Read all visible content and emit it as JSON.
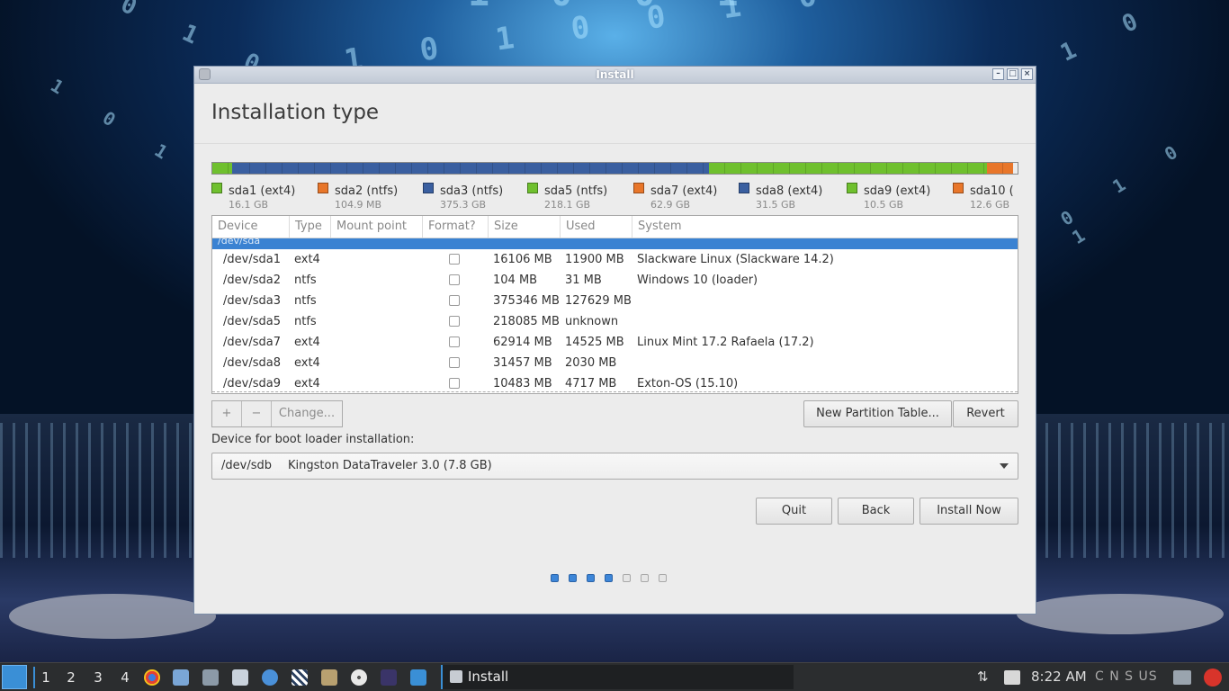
{
  "window": {
    "title": "Install",
    "heading": "Installation type"
  },
  "partition_bar": [
    {
      "color": "#6fc02e",
      "fraction": 0.025
    },
    {
      "color": "#3a5fa0",
      "fraction": 0.0015
    },
    {
      "color": "#3a5fa0",
      "fraction": 0.59
    },
    {
      "color": "#6fc02e",
      "fraction": 0.345
    },
    {
      "color": "#e8762a",
      "fraction": 0.0335
    }
  ],
  "legend": [
    {
      "name": "sda1 (ext4)",
      "size": "16.1 GB",
      "color": "#6fc02e"
    },
    {
      "name": "sda2 (ntfs)",
      "size": "104.9 MB",
      "color": "#e8762a"
    },
    {
      "name": "sda3 (ntfs)",
      "size": "375.3 GB",
      "color": "#3a5fa0"
    },
    {
      "name": "sda5 (ntfs)",
      "size": "218.1 GB",
      "color": "#6fc02e"
    },
    {
      "name": "sda7 (ext4)",
      "size": "62.9 GB",
      "color": "#e8762a"
    },
    {
      "name": "sda8 (ext4)",
      "size": "31.5 GB",
      "color": "#3a5fa0"
    },
    {
      "name": "sda9 (ext4)",
      "size": "10.5 GB",
      "color": "#6fc02e"
    },
    {
      "name": "sda10 (",
      "size": "12.6 GB",
      "color": "#e8762a"
    }
  ],
  "table": {
    "headers": [
      "Device",
      "Type",
      "Mount point",
      "Format?",
      "Size",
      "Used",
      "System"
    ],
    "group": "/dev/sda",
    "rows": [
      {
        "device": "/dev/sda1",
        "type": "ext4",
        "mount": "",
        "format": false,
        "size": "16106 MB",
        "used": "11900 MB",
        "system": "Slackware Linux (Slackware 14.2)"
      },
      {
        "device": "/dev/sda2",
        "type": "ntfs",
        "mount": "",
        "format": false,
        "size": "104 MB",
        "used": "31 MB",
        "system": "Windows 10 (loader)"
      },
      {
        "device": "/dev/sda3",
        "type": "ntfs",
        "mount": "",
        "format": false,
        "size": "375346 MB",
        "used": "127629 MB",
        "system": ""
      },
      {
        "device": "/dev/sda5",
        "type": "ntfs",
        "mount": "",
        "format": false,
        "size": "218085 MB",
        "used": "unknown",
        "system": ""
      },
      {
        "device": "/dev/sda7",
        "type": "ext4",
        "mount": "",
        "format": false,
        "size": "62914 MB",
        "used": "14525 MB",
        "system": "Linux Mint 17.2 Rafaela (17.2)"
      },
      {
        "device": "/dev/sda8",
        "type": "ext4",
        "mount": "",
        "format": false,
        "size": "31457 MB",
        "used": "2030 MB",
        "system": ""
      },
      {
        "device": "/dev/sda9",
        "type": "ext4",
        "mount": "",
        "format": false,
        "size": "10483 MB",
        "used": "4717 MB",
        "system": "Exton-OS (15.10)"
      }
    ]
  },
  "toolbar": {
    "add": "+",
    "remove": "−",
    "change": "Change...",
    "new_table": "New Partition Table...",
    "revert": "Revert"
  },
  "bootloader": {
    "label": "Device for boot loader installation:",
    "device": "/dev/sdb",
    "description": "Kingston DataTraveler 3.0 (7.8 GB)"
  },
  "buttons": {
    "quit": "Quit",
    "back": "Back",
    "install": "Install Now"
  },
  "progress": {
    "total": 7,
    "done": 4
  },
  "taskbar": {
    "workspaces": [
      "1",
      "2",
      "3",
      "4"
    ],
    "active_workspace": 0,
    "task": "Install",
    "clock": "8:22 AM",
    "indicators": "C N S US"
  }
}
